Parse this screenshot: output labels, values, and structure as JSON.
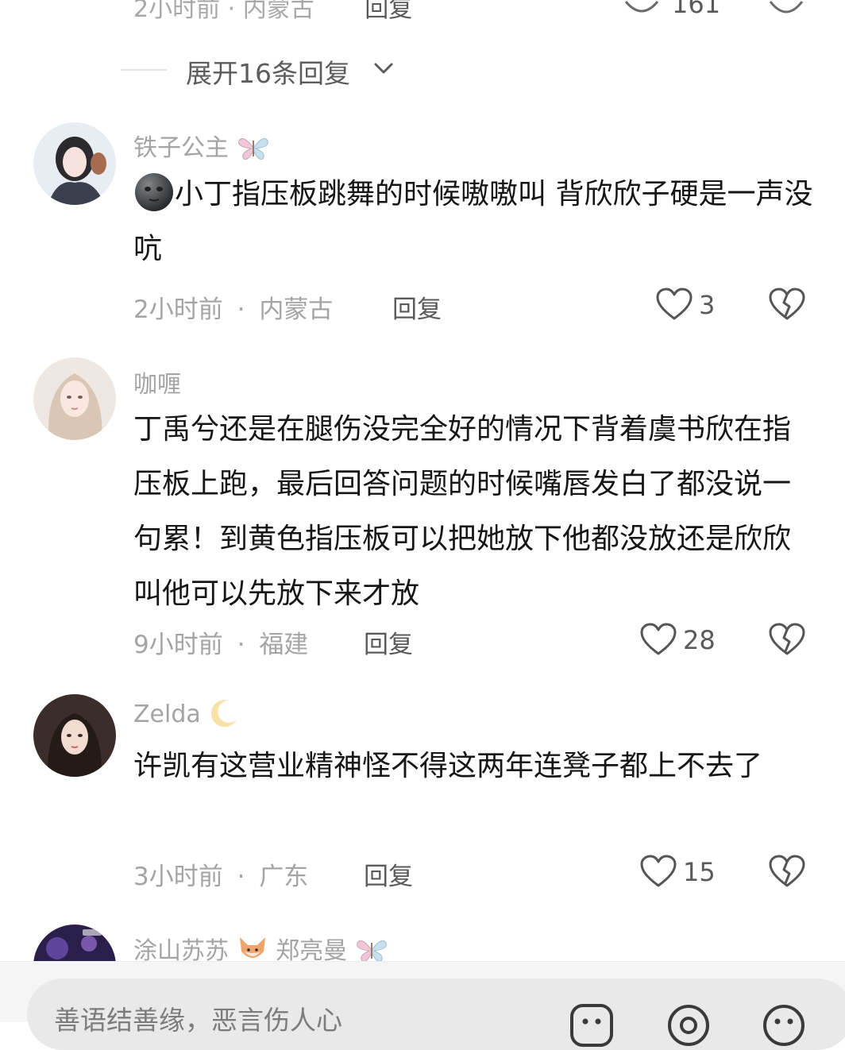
{
  "top_partial": {
    "meta": "2小时前 · 内蒙古",
    "reply": "回复",
    "like_count": "161"
  },
  "expand": {
    "label": "展开16条回复"
  },
  "comments": [
    {
      "username": "铁子公主",
      "name_emoji": "butterfly",
      "lead_emoji": "new-moon-face",
      "text": "小丁指压板跳舞的时候嗷嗷叫 背欣欣子硬是一声没吭",
      "time": "2小时前",
      "location": "内蒙古",
      "reply_label": "回复",
      "likes": "3"
    },
    {
      "username": "咖喱",
      "text": "丁禹兮还是在腿伤没完全好的情况下背着虞书欣在指压板上跑，最后回答问题的时候嘴唇发白了都没说一句累！到黄色指压板可以把她放下他都没放还是欣欣叫他可以先放下来才放",
      "time": "9小时前",
      "location": "福建",
      "reply_label": "回复",
      "likes": "28"
    },
    {
      "username": "Zelda",
      "name_emoji": "crescent-moon",
      "text": "许凯有这营业精神怪不得这两年连凳子都上不去了",
      "time": "3小时前",
      "location": "广东",
      "reply_label": "回复",
      "likes": "15"
    },
    {
      "username_part1": "涂山苏苏",
      "username_part2": "郑亮曼",
      "name_emojis": [
        "fox",
        "butterfly"
      ]
    }
  ],
  "meta_separator": "·",
  "input": {
    "placeholder": "善语结善缘，恶言伤人心"
  },
  "icons": {
    "like": "heart-outline-icon",
    "dislike": "broken-heart-icon",
    "expand": "chevron-down-icon",
    "emoji": "emoji-icon",
    "mention": "at-icon",
    "sticker": "sticker-icon"
  },
  "colors": {
    "text_primary": "#161616",
    "text_secondary": "#a4a4a4",
    "action_text": "#5a5a5a"
  }
}
